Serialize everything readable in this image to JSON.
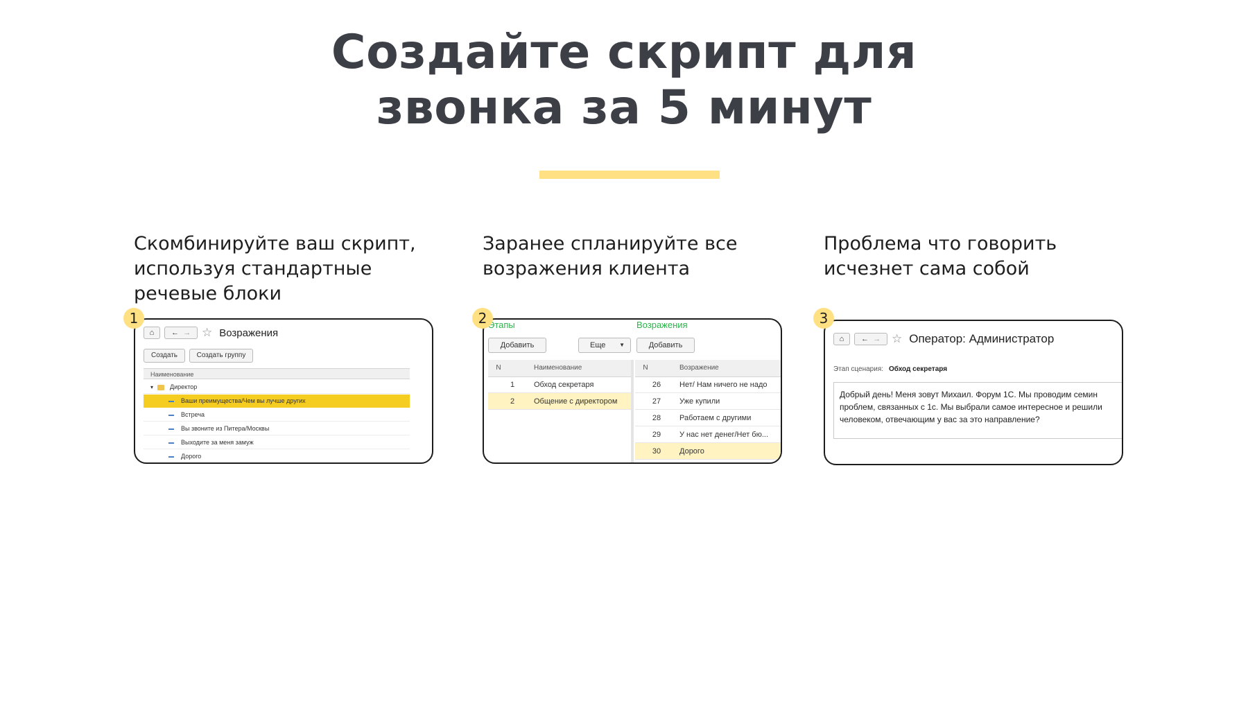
{
  "hero": {
    "title_line1": "Создайте скрипт для",
    "title_line2": "звонка за 5 минут"
  },
  "accent_color": "#ffe184",
  "features": [
    {
      "badge": "1",
      "caption_lines": [
        "Скомбинируйте ваш скрипт,",
        "используя стандартные",
        "речевые блоки"
      ],
      "screenshot": {
        "icons": [
          "home-icon",
          "back-icon",
          "forward-icon",
          "star-icon"
        ],
        "window_title": "Возражения",
        "buttons": [
          "Создать",
          "Создать группу"
        ],
        "column_header": "Наименование",
        "group": "Директор",
        "items": [
          "Ваши преимущества/Чем вы лучше других",
          "Встреча",
          "Вы звоните из Питера/Москвы",
          "Выходите за меня замуж",
          "Дорого"
        ],
        "selected_index": 0
      }
    },
    {
      "badge": "2",
      "caption_lines": [
        "Заранее спланируйте все",
        "возражения клиента"
      ],
      "screenshot": {
        "left_label": "Этапы",
        "right_label": "Возражения",
        "left_buttons": [
          "Добавить",
          "Еще"
        ],
        "right_button": "Добавить",
        "left_headers": [
          "N",
          "Наименование"
        ],
        "right_headers": [
          "N",
          "Возражение"
        ],
        "stages": [
          {
            "n": "1",
            "name": "Обход секретаря"
          },
          {
            "n": "2",
            "name": "Общение с директором"
          }
        ],
        "objections": [
          {
            "n": "26",
            "name": "Нет/ Нам ничего не надо"
          },
          {
            "n": "27",
            "name": "Уже купили"
          },
          {
            "n": "28",
            "name": "Работаем с другими"
          },
          {
            "n": "29",
            "name": "У нас нет денег/Нет бю..."
          },
          {
            "n": "30",
            "name": "Дорого"
          }
        ],
        "highlight_color": "#fff3c2"
      }
    },
    {
      "badge": "3",
      "caption_lines": [
        "Проблема что говорить",
        "исчезнет сама собой"
      ],
      "screenshot": {
        "icons": [
          "home-icon",
          "back-icon",
          "forward-icon",
          "star-icon"
        ],
        "window_title": "Оператор: Администратор",
        "stage_label": "Этап сценария:",
        "stage_value": "Обход секретаря",
        "script_lines": [
          "Добрый день! Меня зовут Михаил. Форум 1С. Мы проводим семин",
          "проблем, связанных с 1с. Мы выбрали самое интересное и решили",
          "человеком, отвечающим у вас за это направление?"
        ]
      }
    }
  ]
}
